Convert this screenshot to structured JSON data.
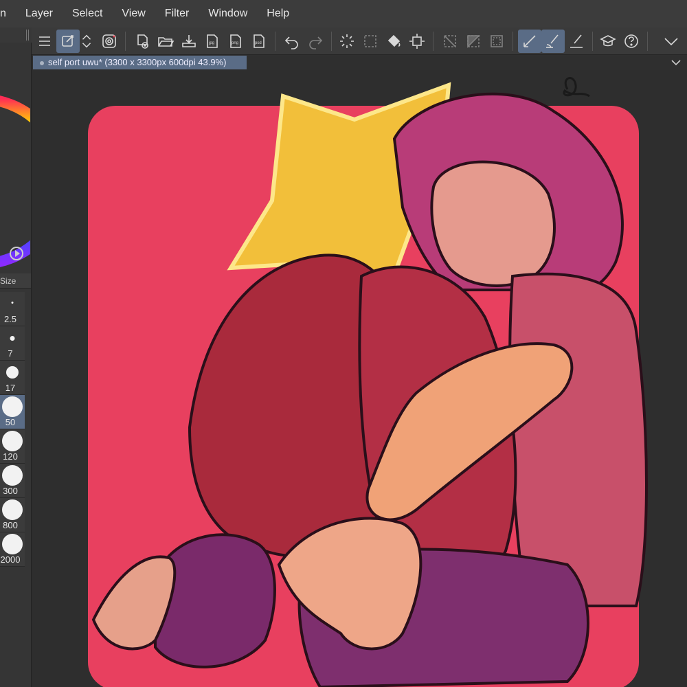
{
  "menu": {
    "items": [
      "n",
      "Layer",
      "Select",
      "View",
      "Filter",
      "Window",
      "Help"
    ]
  },
  "document": {
    "tab_title": "self port uwu* (3300 x 3300px 600dpi 43.9%)"
  },
  "brush_panel": {
    "header": "Size",
    "sizes": [
      "2.5",
      "7",
      "17",
      "50",
      "120",
      "300",
      "800",
      "2000"
    ],
    "selected": "50"
  },
  "colors": {
    "accent": "#5a6c86",
    "menubar": "#3c3c3c",
    "canvas_bg": "#2e2e2e",
    "artwork_bg": "#e8405f",
    "star": "#f2bf3a"
  },
  "icons": [
    "menu-icon",
    "auto-select-icon",
    "up-down-icon",
    "spiral-icon",
    "new-file-icon",
    "open-folder-icon",
    "import-icon",
    "export-jpg-icon",
    "export-png-icon",
    "export-psd-icon",
    "undo-icon",
    "redo-icon",
    "loading-icon",
    "select-all-icon",
    "fill-icon",
    "transform-icon",
    "deselect-icon",
    "invert-selection-icon",
    "border-icon",
    "ruler-snap-icon",
    "brush-snap-icon",
    "pen-snap-icon",
    "learn-icon",
    "help-icon",
    "chevron-down-icon"
  ]
}
